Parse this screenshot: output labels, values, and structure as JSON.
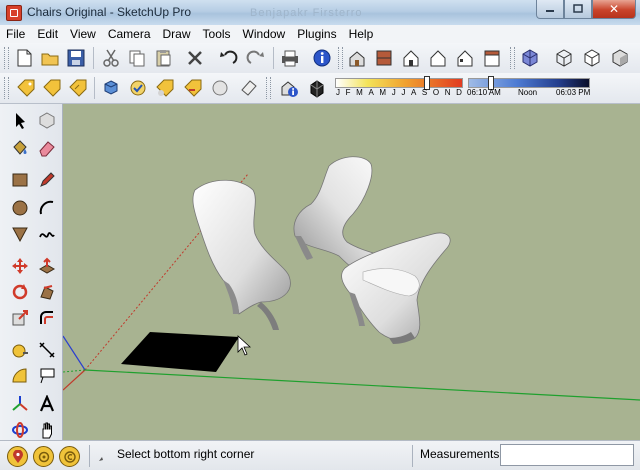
{
  "window": {
    "title": "Chairs Original - SketchUp Pro",
    "background_ghost": "Benjapakr Firsterro",
    "minimize_icon": "minimize-icon",
    "maximize_icon": "maximize-icon",
    "close_label": "✕"
  },
  "menu": [
    "File",
    "Edit",
    "View",
    "Camera",
    "Draw",
    "Tools",
    "Window",
    "Plugins",
    "Help"
  ],
  "shadow": {
    "months": [
      "J",
      "F",
      "M",
      "A",
      "M",
      "J",
      "J",
      "A",
      "S",
      "O",
      "N",
      "D"
    ],
    "time_start": "06:10 AM",
    "time_mid": "Noon",
    "time_end": "06:03 PM",
    "month_position": 0.72,
    "time_position": 0.18
  },
  "status": {
    "hint": "Select bottom right corner",
    "measurements_label": "Measurements",
    "measurements_value": ""
  },
  "colors": {
    "viewport_bg": "#a8b391",
    "axis_red": "#c0392b",
    "axis_green": "#1fa02e",
    "axis_blue": "#2a3fd0"
  }
}
